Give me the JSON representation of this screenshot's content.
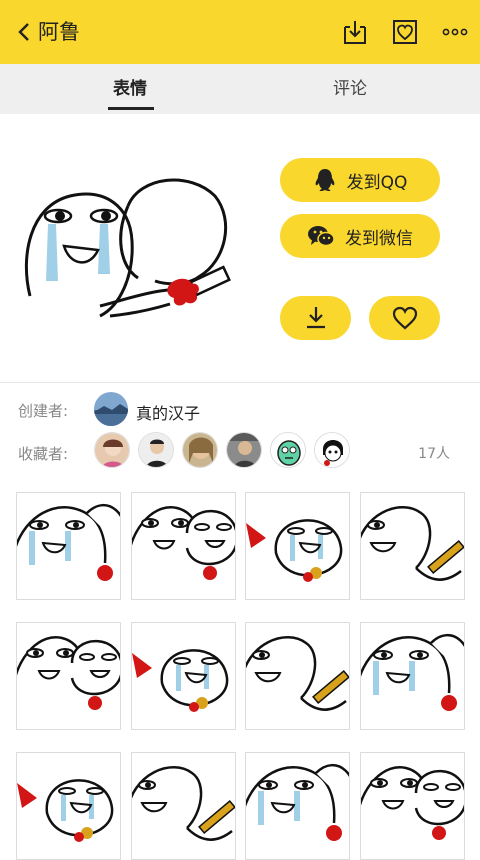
{
  "topbar": {
    "back_icon": "chevron-left-icon",
    "title": "阿鲁",
    "icons": [
      "download-box-icon",
      "heart-box-icon",
      "more-dots-icon"
    ],
    "bg_color": "#f9d72c"
  },
  "tabs": [
    {
      "label": "表情",
      "active": true
    },
    {
      "label": "评论",
      "active": false
    }
  ],
  "actions": {
    "qq_label": "发到QQ",
    "wechat_label": "发到微信",
    "download_icon": "download-icon",
    "favorite_icon": "heart-icon"
  },
  "creator": {
    "label": "创建者:",
    "name": "真的汉子"
  },
  "collectors": {
    "label": "收藏者:",
    "count": "17人",
    "avatars": 6
  },
  "grid": {
    "rows_visible": 3,
    "cols": 4
  }
}
